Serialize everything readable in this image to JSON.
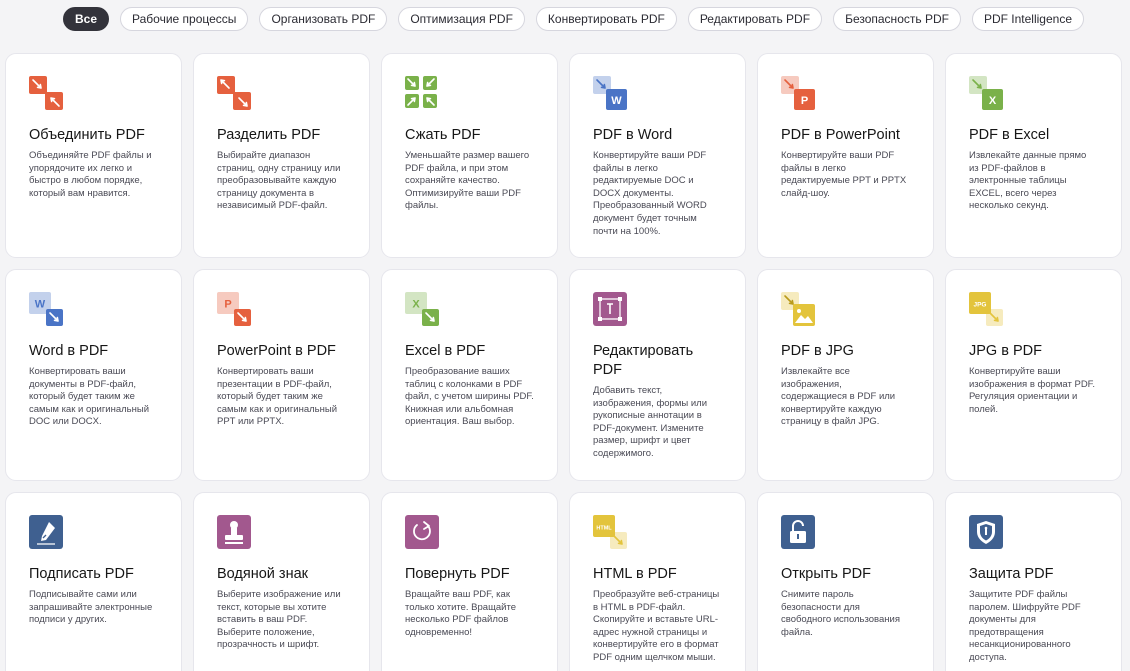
{
  "filters": [
    {
      "label": "Все",
      "active": true
    },
    {
      "label": "Рабочие процессы"
    },
    {
      "label": "Организовать PDF"
    },
    {
      "label": "Оптимизация PDF"
    },
    {
      "label": "Конвертировать PDF"
    },
    {
      "label": "Редактировать PDF"
    },
    {
      "label": "Безопасность PDF"
    },
    {
      "label": "PDF Intelligence"
    }
  ],
  "tools": [
    {
      "icon": "merge-icon",
      "title": "Объединить PDF",
      "desc": "Объединяйте PDF файлы и упорядочите их легко и быстро в любом порядке, который вам нравится."
    },
    {
      "icon": "split-icon",
      "title": "Разделить PDF",
      "desc": "Выбирайте диапазон страниц, одну страницу или преобразовывайте каждую страницу документа в независимый PDF-файл."
    },
    {
      "icon": "compress-icon",
      "title": "Сжать PDF",
      "desc": "Уменьшайте размер вашего PDF файла, и при этом сохраняйте качество. Оптимизируйте ваши PDF файлы."
    },
    {
      "icon": "pdf-to-word-icon",
      "title": "PDF в Word",
      "desc": "Конвертируйте ваши PDF файлы в легко редактируемые DOC и DOCX документы. Преобразованный WORD документ будет точным почти на 100%."
    },
    {
      "icon": "pdf-to-powerpoint-icon",
      "title": "PDF в PowerPoint",
      "desc": "Конвертируйте ваши PDF файлы в легко редактируемые PPT и PPTX слайд-шоу."
    },
    {
      "icon": "pdf-to-excel-icon",
      "title": "PDF в Excel",
      "desc": "Извлекайте данные прямо из PDF-файлов в электронные таблицы EXCEL, всего через несколько секунд."
    },
    {
      "icon": "word-to-pdf-icon",
      "title": "Word в PDF",
      "desc": "Конвертировать ваши документы в PDF-файл, который будет таким же самым как и оригинальный DOC или DOCX."
    },
    {
      "icon": "powerpoint-to-pdf-icon",
      "title": "PowerPoint в PDF",
      "desc": "Конвертировать ваши презентации в PDF-файл, который будет таким же самым как и оригинальный PPT или PPTX."
    },
    {
      "icon": "excel-to-pdf-icon",
      "title": "Excel в PDF",
      "desc": "Преобразование ваших таблиц с колонками в PDF файл, с учетом ширины PDF. Книжная или альбомная ориентация. Ваш выбор."
    },
    {
      "icon": "edit-pdf-icon",
      "title": "Редактировать PDF",
      "desc": "Добавить текст, изображения, формы или рукописные аннотации в PDF-документ. Измените размер, шрифт и цвет содержимого."
    },
    {
      "icon": "pdf-to-jpg-icon",
      "title": "PDF в JPG",
      "desc": "Извлекайте все изображения, содержащиеся в PDF или конвертируйте каждую страницу в файл JPG."
    },
    {
      "icon": "jpg-to-pdf-icon",
      "title": "JPG в PDF",
      "desc": "Конвертируйте ваши изображения в формат PDF. Регуляция ориентации и полей."
    },
    {
      "icon": "sign-pdf-icon",
      "title": "Подписать PDF",
      "desc": "Подписывайте сами или запрашивайте электронные подписи у других."
    },
    {
      "icon": "watermark-icon",
      "title": "Водяной знак",
      "desc": "Выберите изображение или текст, которые вы хотите вставить в ваш PDF. Выберите положение, прозрачность и шрифт."
    },
    {
      "icon": "rotate-pdf-icon",
      "title": "Повернуть PDF",
      "desc": "Вращайте ваш PDF, как только хотите. Вращайте несколько PDF файлов одновременно!"
    },
    {
      "icon": "html-to-pdf-icon",
      "title": "HTML в PDF",
      "desc": "Преобразуйте веб-страницы в HTML в PDF-файл. Скопируйте и вставьте URL-адрес нужной страницы и конвертируйте его в формат PDF одним щелчком мыши."
    },
    {
      "icon": "unlock-pdf-icon",
      "title": "Открыть PDF",
      "desc": "Снимите пароль безопасности для свободного использования файла."
    },
    {
      "icon": "protect-pdf-icon",
      "title": "Защита PDF",
      "desc": "Защитите PDF файлы паролем. Шифруйте PDF документы для предотвращения несанкционированного доступа."
    }
  ],
  "icon_labels": {
    "word": "W",
    "powerpoint": "P",
    "excel": "X",
    "jpg": "JPG",
    "html": "HTML"
  },
  "colors": {
    "red": "#e5603e",
    "green": "#7ab14a",
    "blue": "#4a74c6",
    "purple": "#a2588e",
    "yellow": "#e3c43c",
    "navy": "#3f6090"
  }
}
